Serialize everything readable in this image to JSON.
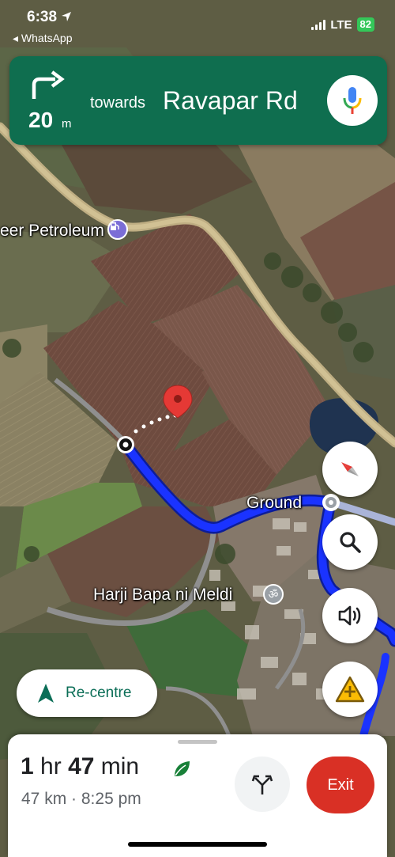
{
  "status_bar": {
    "time": "6:38",
    "back_app": "◂ WhatsApp",
    "network": "LTE",
    "battery": "82"
  },
  "navigation": {
    "distance_value": "20",
    "distance_unit": "m",
    "towards": "towards",
    "street": "Ravapar Rd",
    "maneuver_icon": "turn-right-arrow-icon"
  },
  "map": {
    "labels": {
      "petroleum": "eer Petroleum",
      "ground": "Ground",
      "temple": "Harji Bapa ni Meldi"
    },
    "icons": {
      "petroleum": "gas-station-icon",
      "temple": "om-icon",
      "destination": "red-pin-icon"
    }
  },
  "controls": {
    "recentre_label": "Re-centre",
    "compass": "compass-icon",
    "search": "search-icon",
    "sound": "volume-icon",
    "report": "report-incident-icon"
  },
  "trip": {
    "hours_num": "1",
    "hours_unit": "hr",
    "minutes_num": "47",
    "minutes_unit": "min",
    "distance": "47 km",
    "separator": "·",
    "arrival": "8:25 pm",
    "exit_label": "Exit"
  },
  "colors": {
    "banner": "#0f6e4f",
    "route": "#1a33ff",
    "exit": "#d93025",
    "accent": "#0b6e57"
  }
}
